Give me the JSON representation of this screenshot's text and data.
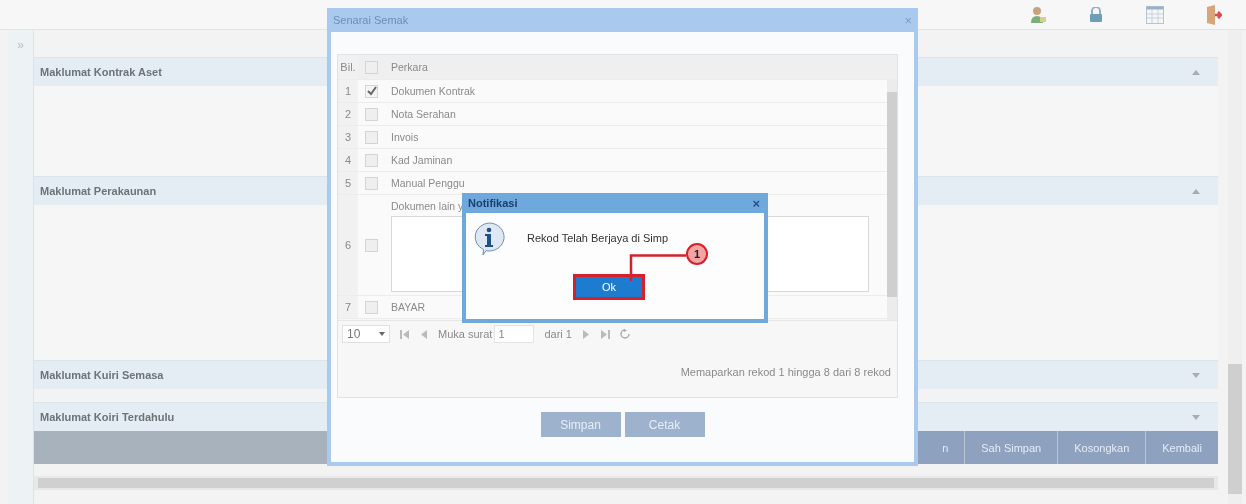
{
  "sidebar": {
    "toggle": "»"
  },
  "sections": [
    {
      "title": "Maklumat Kontrak Aset",
      "expanded": true
    },
    {
      "title": "Maklumat Perakaunan",
      "expanded": true
    },
    {
      "title": "Maklumat Kuiri Semasa",
      "expanded": false
    },
    {
      "title": "Maklumat Koiri Terdahulu",
      "expanded": false
    }
  ],
  "action_buttons": [
    "n",
    "Sah Simpan",
    "Kosongkan",
    "Kembali"
  ],
  "checklist_dialog": {
    "title": "Senarai Semak",
    "close": "×",
    "columns": [
      "Bil.",
      "Perkara"
    ],
    "select_all_checked": false,
    "rows": [
      {
        "number": "1",
        "item": "Dokumen Kontrak",
        "checked": true,
        "kind": "text"
      },
      {
        "number": "2",
        "item": "Nota Serahan",
        "checked": false,
        "kind": "text"
      },
      {
        "number": "3",
        "item": "Invois",
        "checked": false,
        "kind": "text"
      },
      {
        "number": "4",
        "item": "Kad Jaminan",
        "checked": false,
        "kind": "text"
      },
      {
        "number": "5",
        "item": "Manual Penggu",
        "checked": false,
        "kind": "text"
      },
      {
        "number": "6",
        "item": "Dokumen lain y",
        "checked": false,
        "kind": "textarea"
      },
      {
        "number": "7",
        "item": "BAYAR",
        "checked": false,
        "kind": "text"
      }
    ],
    "pager": {
      "page_size": "10",
      "page_label": "Muka surat",
      "page": "1",
      "of_label": "dari 1",
      "summary": "Memaparkan rekod 1 hingga 8 dari 8 rekod"
    },
    "buttons": [
      "Simpan",
      "Cetak"
    ]
  },
  "notification": {
    "title": "Notifikasi",
    "close": "×",
    "message": "Rekod Telah Berjaya di Simp",
    "button": "Ok"
  },
  "callout": {
    "number": "1"
  }
}
